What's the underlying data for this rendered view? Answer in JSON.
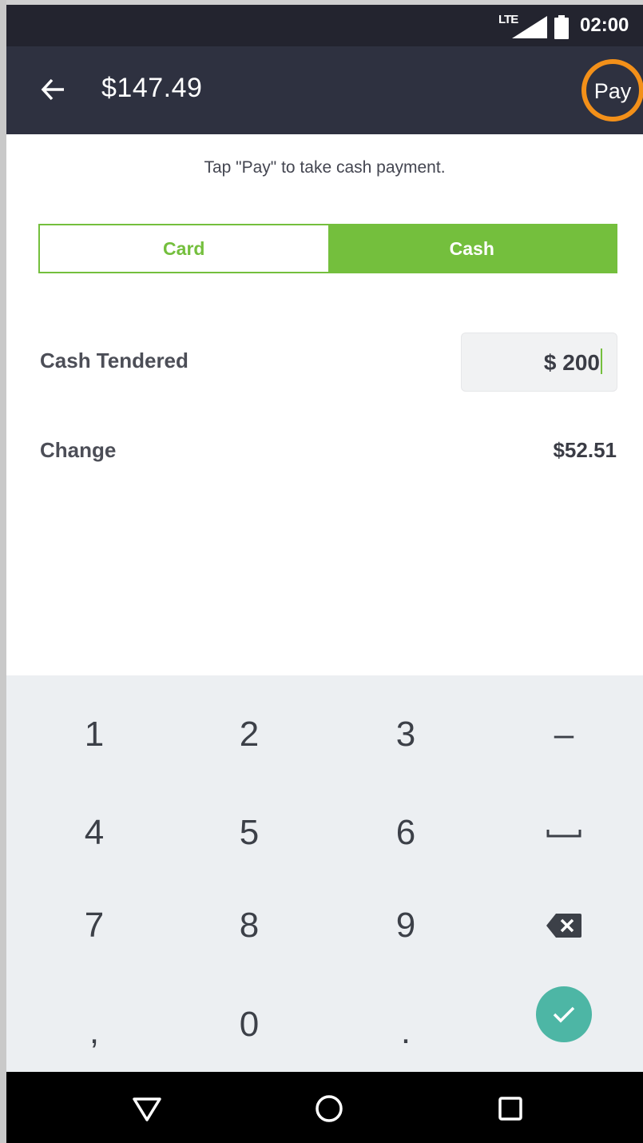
{
  "status_bar": {
    "network": "LTE",
    "time": "02:00",
    "icons": [
      "signal-icon",
      "battery-icon"
    ]
  },
  "app_bar": {
    "back_icon": "arrow-left-icon",
    "amount": "$147.49",
    "pay_label": "Pay",
    "highlight_color": "#f39019"
  },
  "hint": "Tap \"Pay\" to take cash payment.",
  "payment_toggle": {
    "options": [
      "Card",
      "Cash"
    ],
    "selected": "Cash",
    "accent_color": "#74bf3d"
  },
  "cash_tendered": {
    "label": "Cash Tendered",
    "value": "$ 200"
  },
  "change": {
    "label": "Change",
    "value": "$52.51"
  },
  "keypad": {
    "keys": [
      "1",
      "2",
      "3",
      "–",
      "4",
      "5",
      "6",
      "space",
      "7",
      "8",
      "9",
      "backspace",
      ",",
      "0",
      ".",
      "confirm"
    ],
    "confirm_color": "#4db6a5"
  },
  "nav_bar": {
    "icons": [
      "back-triangle-icon",
      "home-circle-icon",
      "recents-square-icon"
    ]
  }
}
